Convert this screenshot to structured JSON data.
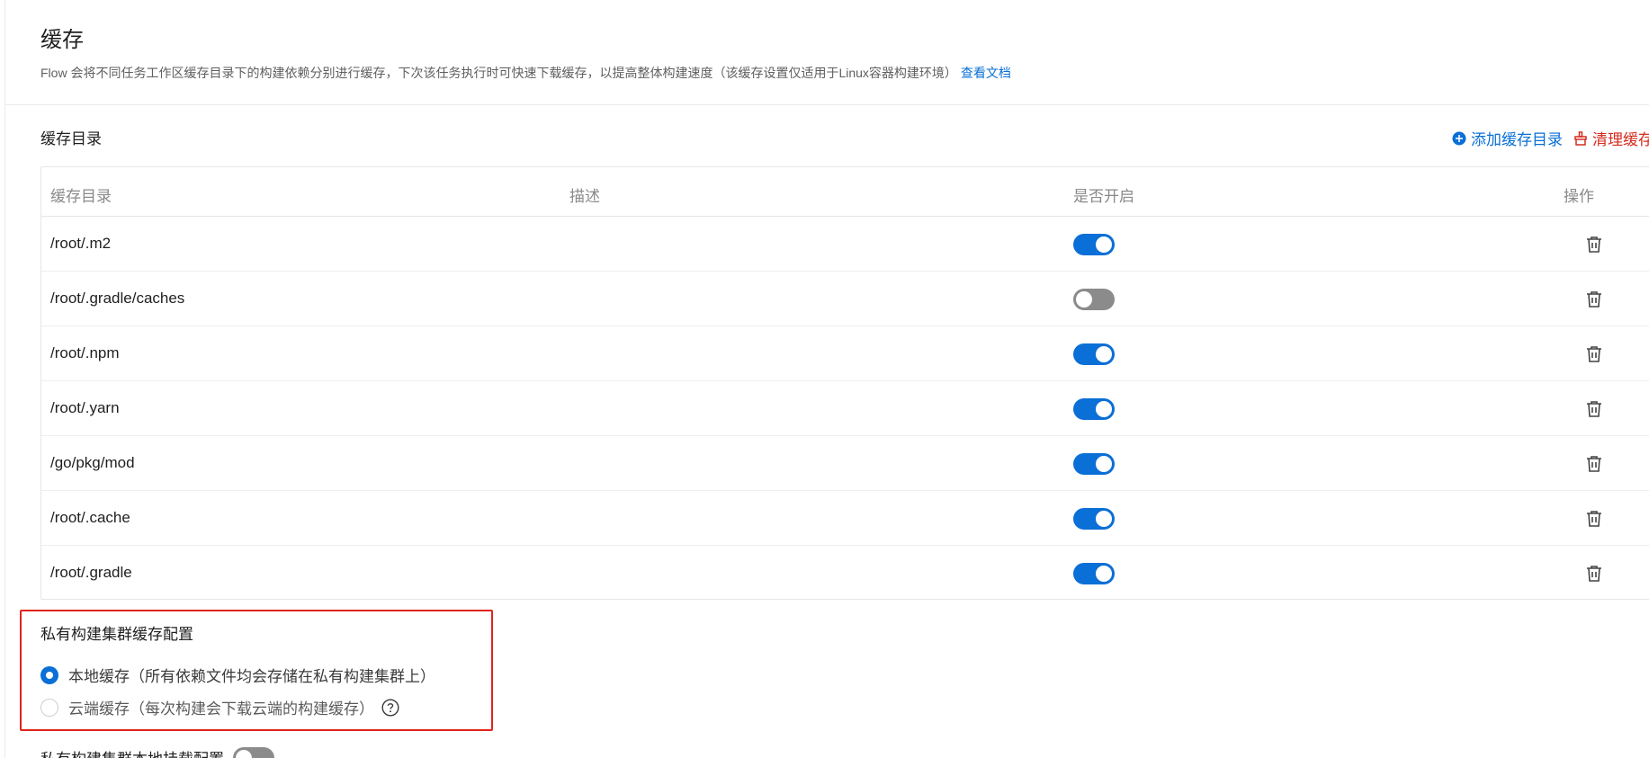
{
  "header": {
    "title": "缓存",
    "description": "Flow 会将不同任务工作区缓存目录下的构建依赖分别进行缓存，下次该任务执行时可快速下载缓存，以提高整体构建速度（该缓存设置仅适用于Linux容器构建环境）",
    "doc_link": "查看文档"
  },
  "cache_section": {
    "title": "缓存目录",
    "add_label": "添加缓存目录",
    "clear_label": "清理缓存"
  },
  "table": {
    "columns": {
      "path": "缓存目录",
      "description": "描述",
      "enabled": "是否开启",
      "actions": "操作"
    },
    "rows": [
      {
        "path": "/root/.m2",
        "description": "",
        "enabled": true
      },
      {
        "path": "/root/.gradle/caches",
        "description": "",
        "enabled": false
      },
      {
        "path": "/root/.npm",
        "description": "",
        "enabled": true
      },
      {
        "path": "/root/.yarn",
        "description": "",
        "enabled": true
      },
      {
        "path": "/go/pkg/mod",
        "description": "",
        "enabled": true
      },
      {
        "path": "/root/.cache",
        "description": "",
        "enabled": true
      },
      {
        "path": "/root/.gradle",
        "description": "",
        "enabled": true
      }
    ]
  },
  "private_cluster": {
    "title": "私有构建集群缓存配置",
    "options": [
      {
        "label": "本地缓存（所有依赖文件均会存储在私有构建集群上）",
        "selected": true
      },
      {
        "label": "云端缓存（每次构建会下载云端的构建缓存）",
        "selected": false
      }
    ],
    "help_icon": "question-circle-icon"
  },
  "mount_config": {
    "label": "私有构建集群本地挂载配置",
    "enabled": false
  },
  "colors": {
    "accent": "#0a6fd6",
    "danger": "#d52b1e",
    "highlight_border": "#e2231a",
    "toggle_off": "#8b8b8b"
  }
}
